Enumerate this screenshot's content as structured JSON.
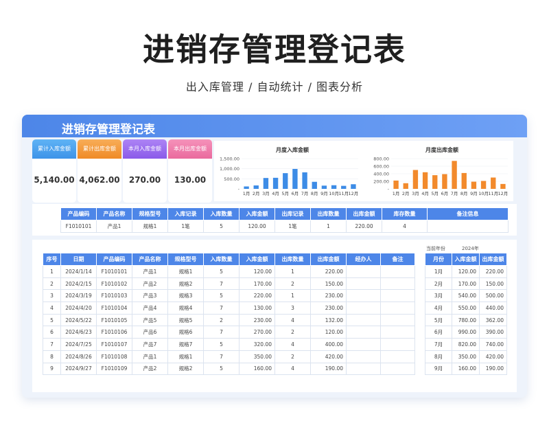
{
  "hero": {
    "title": "进销存管理登记表",
    "subtitle": "出入库管理 / 自动统计 / 图表分析"
  },
  "card": {
    "title": "进销存管理登记表"
  },
  "kpis": [
    {
      "label": "累计入库金额",
      "value": "5,140.00",
      "color": "#4aa3f0"
    },
    {
      "label": "累计出库金额",
      "value": "4,062.00",
      "color": "#f39a3c"
    },
    {
      "label": "本月入库金额",
      "value": "270.00",
      "color": "#9a6df0"
    },
    {
      "label": "本月出库金额",
      "value": "130.00",
      "color": "#f07aa8"
    }
  ],
  "chart_data": [
    {
      "type": "bar",
      "title": "月度入库金额",
      "categories": [
        "1月",
        "2月",
        "3月",
        "4月",
        "5月",
        "6月",
        "7月",
        "8月",
        "9月",
        "10月",
        "11月",
        "12月"
      ],
      "values": [
        120,
        170,
        540,
        550,
        780,
        990,
        820,
        350,
        160,
        180,
        150,
        230
      ],
      "y_ticks": [
        "1,500.00",
        "1,000.00",
        "500.00",
        "-"
      ],
      "ylim": [
        0,
        1500
      ],
      "color": "#3d8ce6"
    },
    {
      "type": "bar",
      "title": "月度出库金额",
      "categories": [
        "1月",
        "2月",
        "3月",
        "4月",
        "5月",
        "6月",
        "7月",
        "8月",
        "9月",
        "10月",
        "11月",
        "12月"
      ],
      "values": [
        220,
        150,
        500,
        440,
        362,
        390,
        740,
        420,
        190,
        210,
        300,
        130
      ],
      "y_ticks": [
        "800.00",
        "600.00",
        "400.00",
        "200.00",
        "-"
      ],
      "ylim": [
        0,
        800
      ],
      "color": "#f28a2c"
    }
  ],
  "lookup": {
    "headers": [
      "产品编码",
      "产品名称",
      "规格型号",
      "入库记录",
      "入库数量",
      "入库金额",
      "出库记录",
      "出库数量",
      "出库金额",
      "库存数量",
      "备注信息"
    ],
    "row": [
      "F1010101",
      "产品1",
      "规格1",
      "1笔",
      "5",
      "120.00",
      "1笔",
      "1",
      "220.00",
      "4",
      ""
    ]
  },
  "year": {
    "label": "当前年份",
    "value": "2024年"
  },
  "main_table": {
    "headers": [
      "序号",
      "日期",
      "产品编码",
      "产品名称",
      "规格型号",
      "入库数量",
      "入库金额",
      "出库数量",
      "出库金额",
      "经办人",
      "备注"
    ],
    "rows": [
      [
        "1",
        "2024/1/14",
        "F1010101",
        "产品1",
        "规格1",
        "5",
        "120.00",
        "1",
        "220.00",
        "",
        ""
      ],
      [
        "2",
        "2024/2/15",
        "F1010102",
        "产品2",
        "规格2",
        "7",
        "170.00",
        "2",
        "150.00",
        "",
        ""
      ],
      [
        "3",
        "2024/3/19",
        "F1010103",
        "产品3",
        "规格3",
        "5",
        "220.00",
        "1",
        "230.00",
        "",
        ""
      ],
      [
        "4",
        "2024/4/20",
        "F1010104",
        "产品4",
        "规格4",
        "7",
        "130.00",
        "3",
        "230.00",
        "",
        ""
      ],
      [
        "5",
        "2024/5/22",
        "F1010105",
        "产品5",
        "规格5",
        "2",
        "230.00",
        "4",
        "132.00",
        "",
        ""
      ],
      [
        "6",
        "2024/6/23",
        "F1010106",
        "产品6",
        "规格6",
        "7",
        "270.00",
        "2",
        "120.00",
        "",
        ""
      ],
      [
        "7",
        "2024/7/25",
        "F1010107",
        "产品7",
        "规格7",
        "5",
        "320.00",
        "4",
        "400.00",
        "",
        ""
      ],
      [
        "8",
        "2024/8/26",
        "F1010108",
        "产品1",
        "规格1",
        "7",
        "350.00",
        "2",
        "420.00",
        "",
        ""
      ],
      [
        "9",
        "2024/9/27",
        "F1010109",
        "产品2",
        "规格2",
        "5",
        "160.00",
        "4",
        "190.00",
        "",
        ""
      ]
    ]
  },
  "month_table": {
    "headers": [
      "月份",
      "入库金额",
      "出库金额"
    ],
    "rows": [
      [
        "1月",
        "120.00",
        "220.00"
      ],
      [
        "2月",
        "170.00",
        "150.00"
      ],
      [
        "3月",
        "540.00",
        "500.00"
      ],
      [
        "4月",
        "550.00",
        "440.00"
      ],
      [
        "5月",
        "780.00",
        "362.00"
      ],
      [
        "6月",
        "990.00",
        "390.00"
      ],
      [
        "7月",
        "820.00",
        "740.00"
      ],
      [
        "8月",
        "350.00",
        "420.00"
      ],
      [
        "9月",
        "160.00",
        "190.00"
      ]
    ]
  }
}
